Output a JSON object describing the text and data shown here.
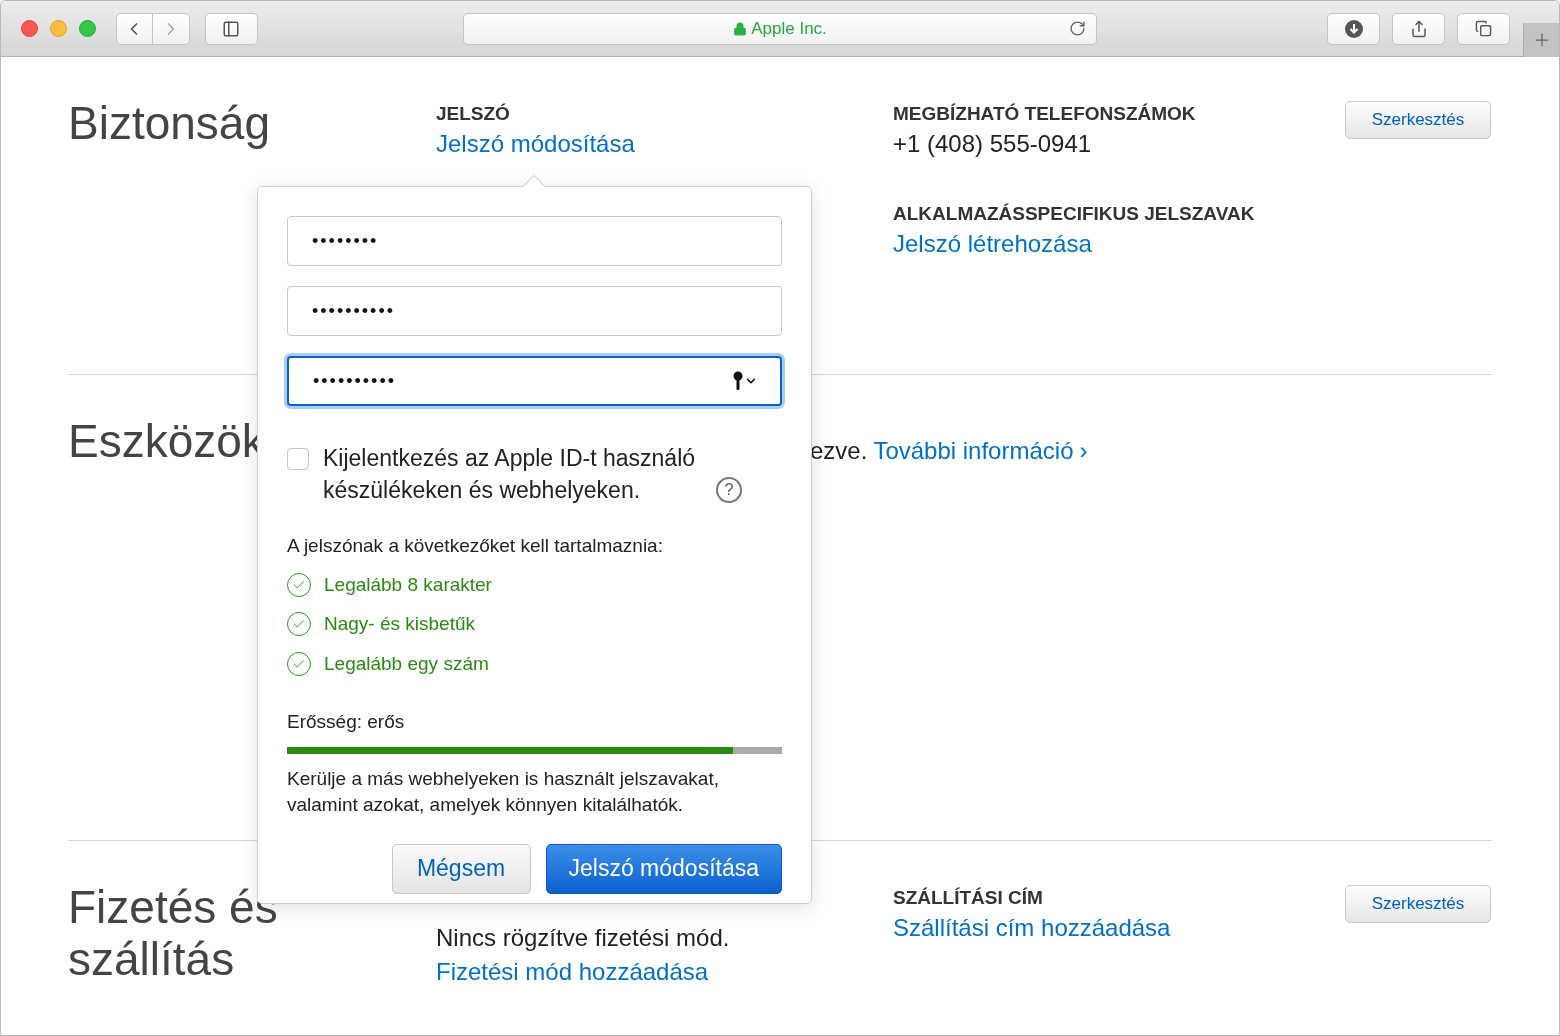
{
  "browser": {
    "address": "Apple Inc.",
    "secure": true
  },
  "sections": [
    {
      "title": "Biztonság",
      "middle": [
        {
          "heading": "JELSZÓ",
          "items": [
            {
              "kind": "link",
              "text": "Jelszó módosítása"
            }
          ]
        }
      ],
      "right": [
        {
          "heading": "MEGBÍZHATÓ TELEFONSZÁMOK",
          "items": [
            {
              "kind": "text",
              "text": "+1 (408) 555-0941"
            }
          ]
        },
        {
          "heading": "ALKALMAZÁSSPECIFIKUS JELSZAVAK",
          "items": [
            {
              "kind": "link",
              "text": "Jelszó létrehozása"
            }
          ]
        }
      ],
      "button": "Szerkesztés"
    },
    {
      "title": "Eszközök",
      "note": {
        "text": "ezve.",
        "link": "További információ",
        "chevron": "›"
      }
    },
    {
      "title": "Fizetés és szállítás",
      "middle": [
        {
          "items": [
            {
              "kind": "text",
              "text": "Nincs rögzítve fizetési mód."
            },
            {
              "kind": "link",
              "text": "Fizetési mód hozzáadása"
            }
          ]
        }
      ],
      "right": [
        {
          "heading": "SZÁLLÍTÁSI CÍM",
          "items": [
            {
              "kind": "link",
              "text": "Szállítási cím hozzáadása"
            }
          ]
        }
      ],
      "button": "Szerkesztés"
    }
  ],
  "popover": {
    "fields": [
      {
        "value": "••••••••",
        "focused": false
      },
      {
        "value": "••••••••••",
        "focused": false
      },
      {
        "value": "••••••••••",
        "focused": true
      }
    ],
    "signout": {
      "label": "Kijelentkezés az Apple ID-t használó készülékeken és webhelyeken.",
      "checked": false,
      "help": "?"
    },
    "requirements_title": "A jelszónak a következőket kell tartalmaznia:",
    "requirements": [
      {
        "text": "Legalább 8 karakter",
        "met": true
      },
      {
        "text": "Nagy- és kisbetűk",
        "met": true
      },
      {
        "text": "Legalább egy szám",
        "met": true
      }
    ],
    "strength": {
      "label": "Erősség: erős",
      "level": 0.9
    },
    "hint": "Kerülje a más webhelyeken is használt jelszavakat, valamint azokat, amelyek könnyen kitalálhatók.",
    "buttons": [
      {
        "kind": "secondary",
        "label": "Mégsem"
      },
      {
        "kind": "primary",
        "label": "Jelszó módosítása"
      }
    ]
  }
}
